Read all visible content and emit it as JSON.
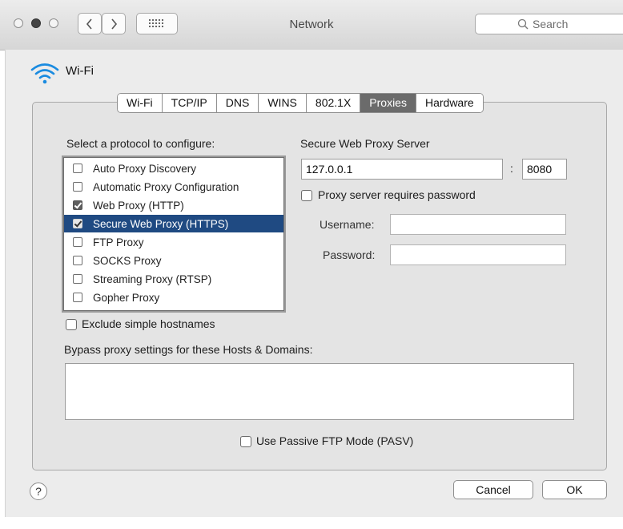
{
  "window": {
    "title": "Network"
  },
  "search": {
    "placeholder": "Search"
  },
  "service": {
    "name": "Wi-Fi"
  },
  "tabs": [
    {
      "label": "Wi-Fi",
      "active": false
    },
    {
      "label": "TCP/IP",
      "active": false
    },
    {
      "label": "DNS",
      "active": false
    },
    {
      "label": "WINS",
      "active": false
    },
    {
      "label": "802.1X",
      "active": false
    },
    {
      "label": "Proxies",
      "active": true
    },
    {
      "label": "Hardware",
      "active": false
    }
  ],
  "protocols": {
    "heading": "Select a protocol to configure:",
    "items": [
      {
        "label": "Auto Proxy Discovery",
        "checked": false,
        "selected": false
      },
      {
        "label": "Automatic Proxy Configuration",
        "checked": false,
        "selected": false
      },
      {
        "label": "Web Proxy (HTTP)",
        "checked": true,
        "selected": false
      },
      {
        "label": "Secure Web Proxy (HTTPS)",
        "checked": true,
        "selected": true
      },
      {
        "label": "FTP Proxy",
        "checked": false,
        "selected": false
      },
      {
        "label": "SOCKS Proxy",
        "checked": false,
        "selected": false
      },
      {
        "label": "Streaming Proxy (RTSP)",
        "checked": false,
        "selected": false
      },
      {
        "label": "Gopher Proxy",
        "checked": false,
        "selected": false
      }
    ]
  },
  "server": {
    "heading": "Secure Web Proxy Server",
    "host": "127.0.0.1",
    "separator": ":",
    "port": "8080",
    "requires_password_label": "Proxy server requires password",
    "requires_password": false,
    "username_label": "Username:",
    "username": "",
    "password_label": "Password:",
    "password": ""
  },
  "exclude": {
    "label": "Exclude simple hostnames",
    "checked": false
  },
  "bypass": {
    "label": "Bypass proxy settings for these Hosts & Domains:",
    "value": ""
  },
  "passive_ftp": {
    "label": "Use Passive FTP Mode (PASV)",
    "checked": false
  },
  "buttons": {
    "help": "?",
    "cancel": "Cancel",
    "ok": "OK"
  }
}
